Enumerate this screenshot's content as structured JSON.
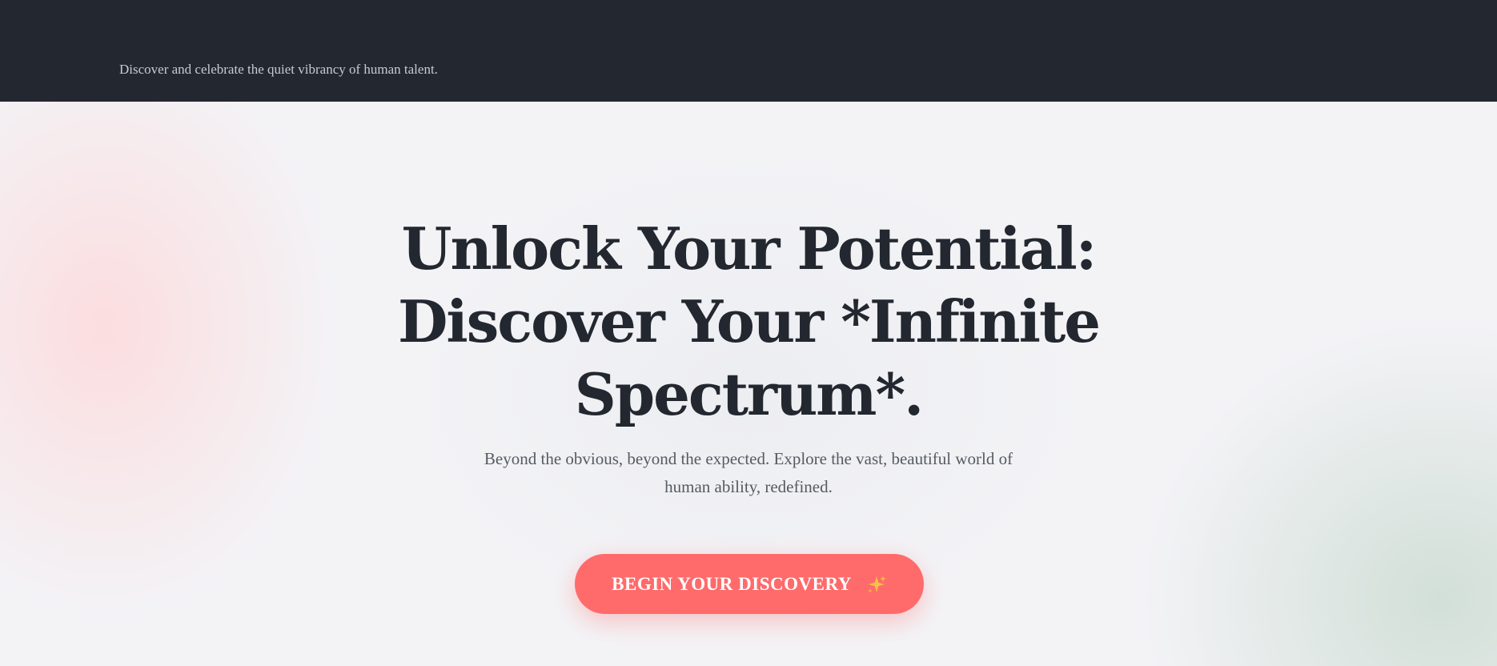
{
  "header": {
    "tagline": "Discover and celebrate the quiet vibrancy of human talent."
  },
  "hero": {
    "headline_line1": "Unlock Your Potential:",
    "headline_line2": "Discover Your *Infinite",
    "headline_line3": "Spectrum*.",
    "subtext_line1": "Beyond the obvious, beyond the expected. Explore the vast, beautiful world of",
    "subtext_line2": "human ability, redefined.",
    "cta_label": "BEGIN YOUR DISCOVERY",
    "cta_icon": "sparkles-icon"
  },
  "colors": {
    "header_bg": "#232730",
    "accent": "#ff6b6b",
    "headline": "#232730",
    "sparkle": "#f5c242"
  }
}
